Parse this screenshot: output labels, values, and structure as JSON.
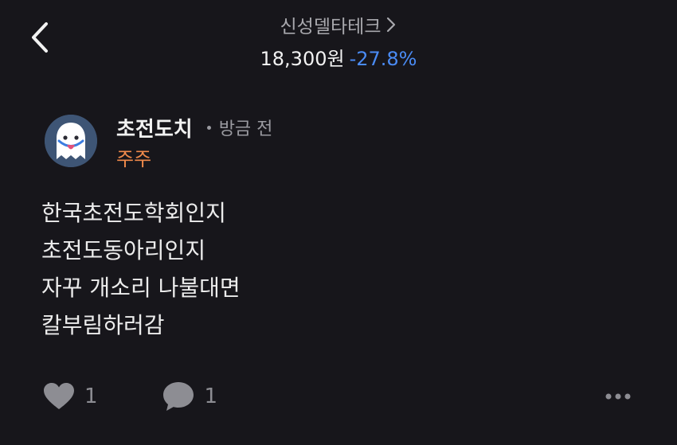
{
  "header": {
    "stock_name": "신성델타테크",
    "price": "18,300원",
    "change": "-27.8%"
  },
  "post": {
    "author": "초전도치",
    "time": "방금 전",
    "role": "주주",
    "lines": [
      "한국초전도학회인지",
      "초전도동아리인지",
      "자꾸 개소리 나불대면",
      "칼부림하러감"
    ]
  },
  "actions": {
    "like_count": "1",
    "comment_count": "1"
  },
  "icons": {
    "back": "chevron-left-icon",
    "stock_link": "chevron-right-icon",
    "like": "heart-icon",
    "comment": "comment-bubble-icon",
    "more": "more-dots-icon",
    "avatar": "ghost-avatar"
  },
  "colors": {
    "background": "#17161b",
    "price_change": "#4a8bf4",
    "role_badge": "#f08a4b",
    "muted": "#9a9aa0"
  }
}
